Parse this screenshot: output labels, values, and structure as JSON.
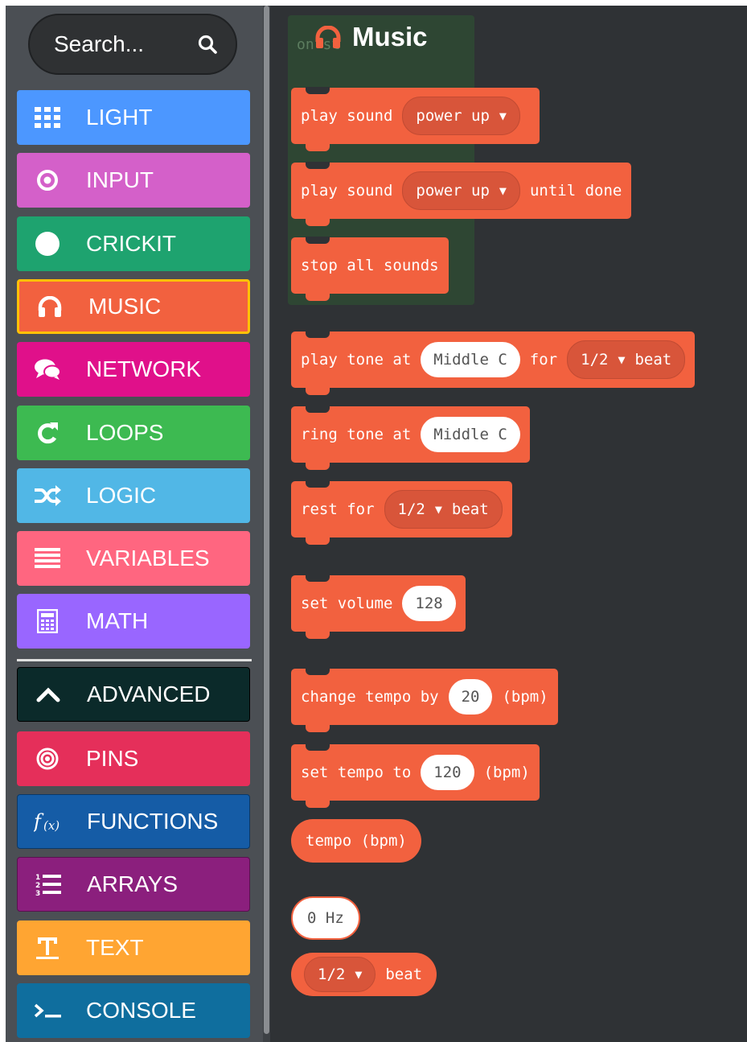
{
  "search": {
    "placeholder": "Search..."
  },
  "categories": [
    {
      "label": "LIGHT",
      "icon": "grid-icon",
      "color": "#4c97ff"
    },
    {
      "label": "INPUT",
      "icon": "target-icon",
      "color": "#d460c9"
    },
    {
      "label": "CRICKIT",
      "icon": "circle-icon",
      "color": "#1ea36f"
    },
    {
      "label": "MUSIC",
      "icon": "headphones-icon",
      "color": "#f2613f"
    },
    {
      "label": "NETWORK",
      "icon": "chat-icon",
      "color": "#e0108a"
    },
    {
      "label": "LOOPS",
      "icon": "refresh-icon",
      "color": "#3dba51"
    },
    {
      "label": "LOGIC",
      "icon": "shuffle-icon",
      "color": "#51b7e6"
    },
    {
      "label": "VARIABLES",
      "icon": "lines-icon",
      "color": "#ff6680"
    },
    {
      "label": "MATH",
      "icon": "calculator-icon",
      "color": "#9966ff"
    },
    {
      "label": "ADVANCED",
      "icon": "chevron-up-icon",
      "color": "#0b2a2a"
    },
    {
      "label": "PINS",
      "icon": "rings-icon",
      "color": "#e52f5a"
    },
    {
      "label": "FUNCTIONS",
      "icon": "function-icon",
      "color": "#155ca6"
    },
    {
      "label": "ARRAYS",
      "icon": "numbered-list-icon",
      "color": "#8b1f7d"
    },
    {
      "label": "TEXT",
      "icon": "text-icon",
      "color": "#ffa532"
    },
    {
      "label": "CONSOLE",
      "icon": "terminal-icon",
      "color": "#0f6e9e"
    }
  ],
  "flyout": {
    "title": "Music",
    "ghost_text": "on st",
    "blocks": {
      "play_sound": {
        "t1": "play sound",
        "dd": "power up"
      },
      "play_sound_until": {
        "t1": "play sound",
        "dd": "power up",
        "t2": "until done"
      },
      "stop_all": {
        "t1": "stop all sounds"
      },
      "play_tone": {
        "t1": "play tone at",
        "note": "Middle C",
        "t2": "for",
        "dd": "1/2",
        "t3": "beat"
      },
      "ring_tone": {
        "t1": "ring tone at",
        "note": "Middle C"
      },
      "rest": {
        "t1": "rest for",
        "dd": "1/2",
        "t2": "beat"
      },
      "set_volume": {
        "t1": "set volume",
        "val": "128"
      },
      "change_tempo": {
        "t1": "change tempo by",
        "val": "20",
        "t2": "(bpm)"
      },
      "set_tempo": {
        "t1": "set tempo to",
        "val": "120",
        "t2": "(bpm)"
      },
      "tempo": {
        "t1": "tempo (bpm)"
      },
      "hz": {
        "t1": "0 Hz"
      },
      "beat": {
        "dd": "1/2",
        "t1": "beat"
      }
    }
  }
}
